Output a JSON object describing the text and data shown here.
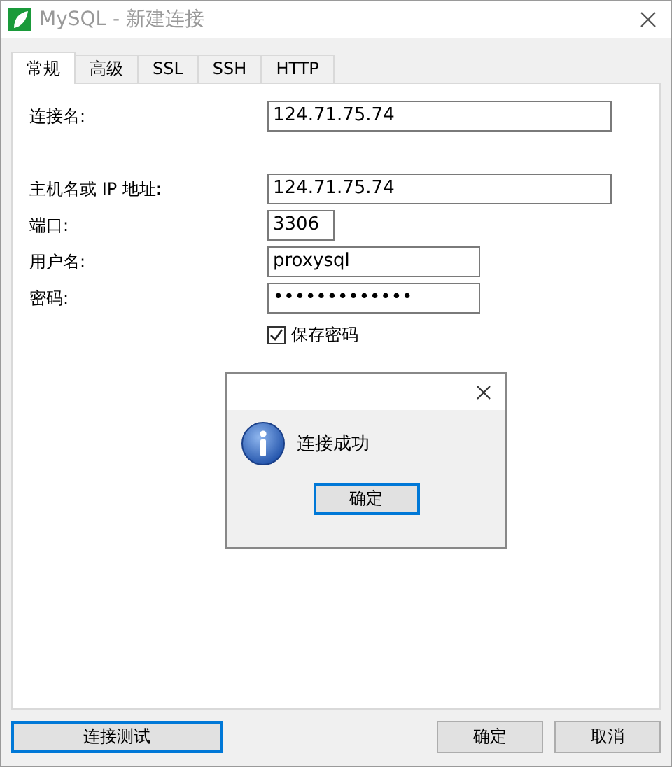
{
  "window": {
    "title": "MySQL - 新建连接"
  },
  "tabs": [
    {
      "label": "常规",
      "selected": true
    },
    {
      "label": "高级",
      "selected": false
    },
    {
      "label": "SSL",
      "selected": false
    },
    {
      "label": "SSH",
      "selected": false
    },
    {
      "label": "HTTP",
      "selected": false
    }
  ],
  "fields": [
    {
      "label": "连接名:",
      "value": "124.71.75.74"
    },
    {
      "label": "主机名或 IP 地址:",
      "value": "124.71.75.74"
    },
    {
      "label": "端口:",
      "value": "3306"
    },
    {
      "label": "用户名:",
      "value": "proxysql"
    },
    {
      "label": "密码:",
      "value": "•••••••••••••"
    }
  ],
  "save_password": {
    "label": "保存密码",
    "checked": true
  },
  "message_box": {
    "text": "连接成功",
    "button": {
      "label": "确定",
      "focused": true
    }
  },
  "buttons": [
    {
      "label": "连接测试",
      "focused": true
    },
    {
      "label": "确定",
      "focused": false
    },
    {
      "label": "取消",
      "focused": false
    }
  ]
}
